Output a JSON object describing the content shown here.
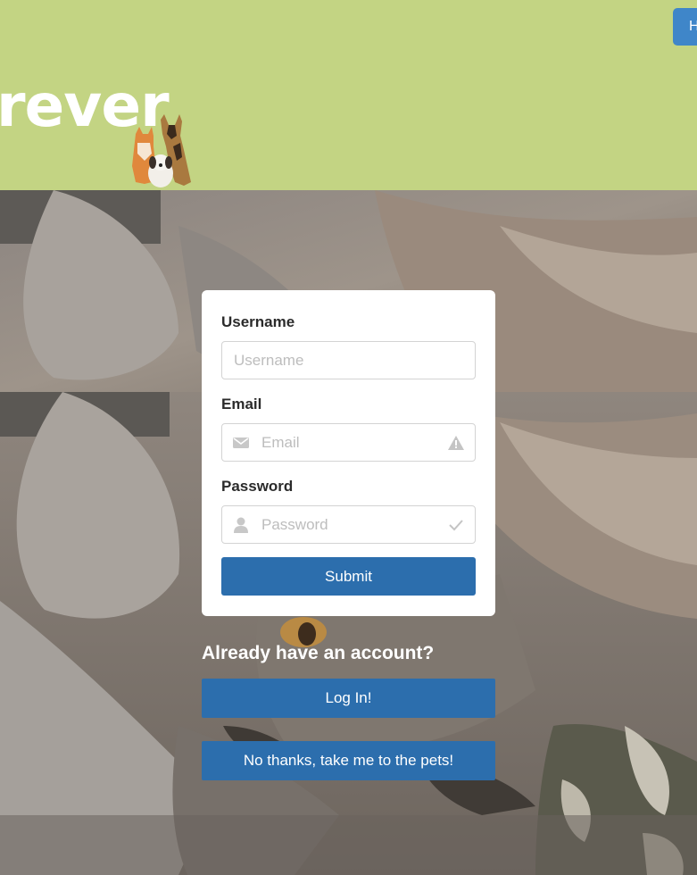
{
  "header": {
    "logo_text": "rever",
    "top_button_label": "H",
    "background_color": "#c3d483"
  },
  "form": {
    "username": {
      "label": "Username",
      "placeholder": "Username",
      "value": ""
    },
    "email": {
      "label": "Email",
      "placeholder": "Email",
      "value": "",
      "left_icon": "envelope-icon",
      "right_icon": "warning-icon"
    },
    "password": {
      "label": "Password",
      "placeholder": "Password",
      "value": "",
      "left_icon": "user-icon",
      "right_icon": "checkmark-icon"
    },
    "submit_label": "Submit"
  },
  "login_prompt": {
    "question": "Already have an account?",
    "login_label": "Log In!",
    "skip_label": "No thanks, take me to the pets!"
  },
  "colors": {
    "primary_button": "#2c6ead",
    "header_button": "#3f86c9"
  }
}
